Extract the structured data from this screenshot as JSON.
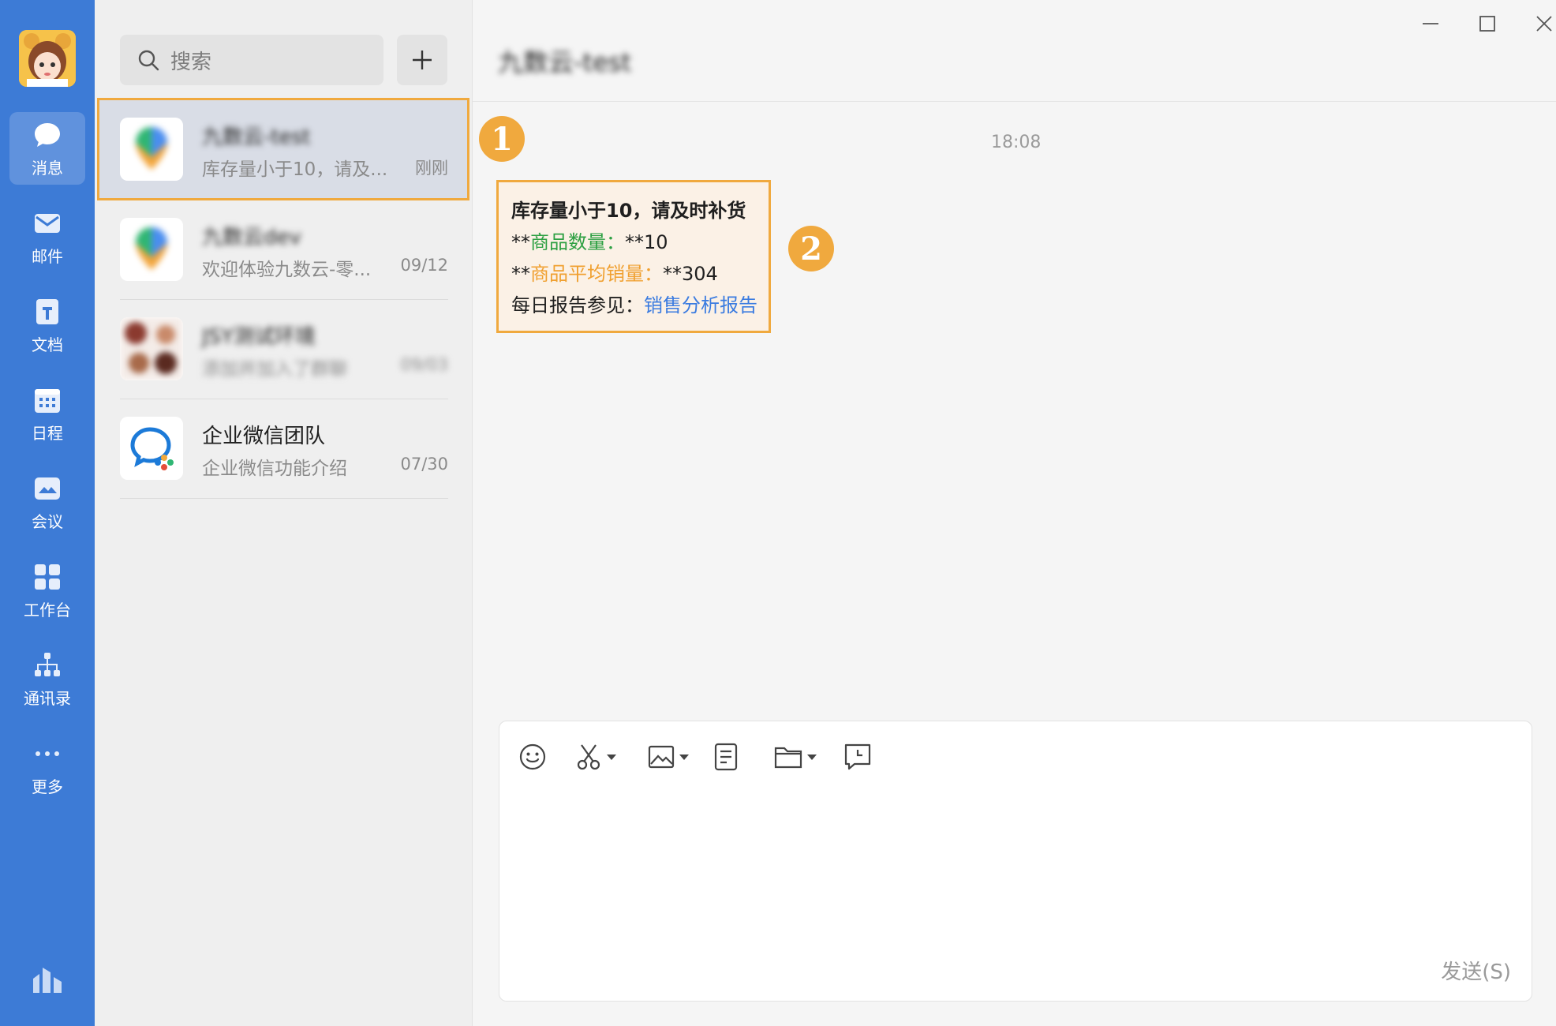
{
  "rail": {
    "items": [
      {
        "label": "消息",
        "icon": "chat-bubble-icon",
        "active": true
      },
      {
        "label": "邮件",
        "icon": "mail-icon"
      },
      {
        "label": "文档",
        "icon": "document-icon"
      },
      {
        "label": "日程",
        "icon": "calendar-icon"
      },
      {
        "label": "会议",
        "icon": "meeting-icon"
      },
      {
        "label": "工作台",
        "icon": "workbench-grid-icon"
      },
      {
        "label": "通讯录",
        "icon": "org-chart-icon"
      },
      {
        "label": "更多",
        "icon": "more-dots-icon"
      }
    ]
  },
  "search": {
    "placeholder": "搜索"
  },
  "conversations": [
    {
      "title": "九数云-test",
      "preview": "库存量小于10，请及...",
      "time": "刚刚",
      "selected": true,
      "blurred_title": true
    },
    {
      "title": "九数云dev",
      "preview": "欢迎体验九数云-零...",
      "time": "09/12",
      "blurred_title": true
    },
    {
      "title": "JSY测试环境",
      "preview": "添加并加入了群聊",
      "time": "09/03",
      "blurred": true
    },
    {
      "title": "企业微信团队",
      "preview": "企业微信功能介绍",
      "time": "07/30"
    }
  ],
  "chat": {
    "title": "九数云-test",
    "time": "18:08",
    "message": {
      "title": "库存量小于10，请及时补货",
      "line1_prefix": "**",
      "line1_key": "商品数量：",
      "line1_value": "**10",
      "line2_prefix": "**",
      "line2_key": "商品平均销量：",
      "line2_value": "**304",
      "line3_text": "每日报告参见：",
      "line3_link": "销售分析报告"
    },
    "badges": [
      "1",
      "2"
    ]
  },
  "composer": {
    "tools": [
      "emoji-icon",
      "screenshot-scissors-icon",
      "image-icon",
      "notes-icon",
      "folder-icon",
      "schedule-message-icon"
    ],
    "send_label": "发送(S)"
  },
  "colors": {
    "rail": "#3d7bd6",
    "highlight": "#f0a93e",
    "green": "#2ea043",
    "orange": "#f0a030",
    "link": "#3a7be0"
  }
}
